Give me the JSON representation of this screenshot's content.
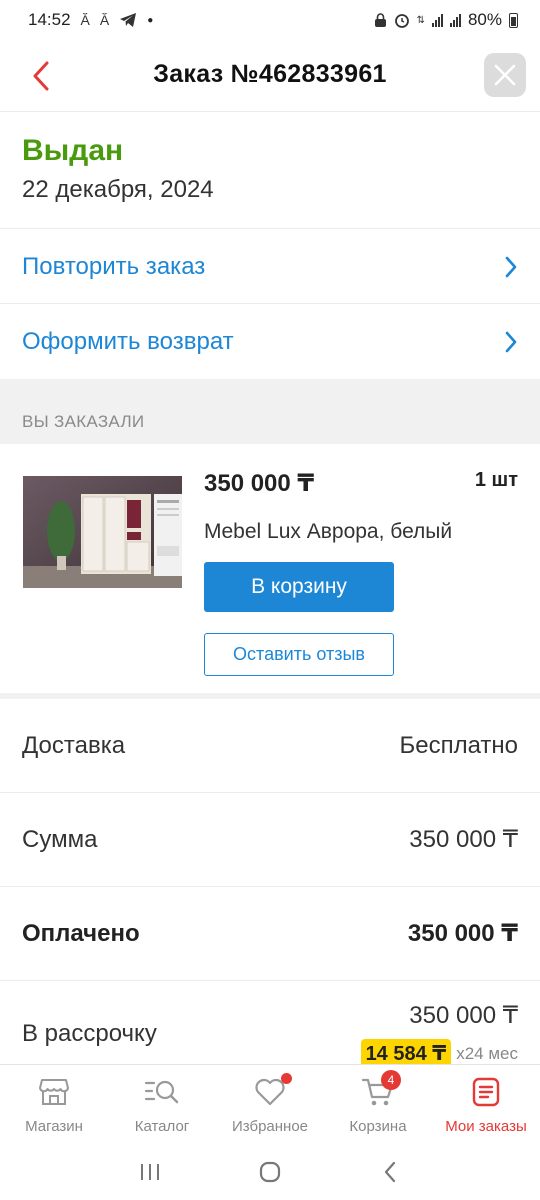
{
  "status_bar": {
    "time": "14:52",
    "battery": "80%"
  },
  "header": {
    "title": "Заказ №462833961"
  },
  "order": {
    "status": "Выдан",
    "date": "22 декабря, 2024"
  },
  "actions": [
    {
      "label": "Повторить заказ"
    },
    {
      "label": "Оформить возврат"
    }
  ],
  "section_title": "ВЫ ЗАКАЗАЛИ",
  "product": {
    "price": "350 000 ₸",
    "quantity": "1 шт",
    "name": "Mebel Lux Аврора, белый",
    "cart_button": "В корзину",
    "review_button": "Оставить отзыв"
  },
  "summary": {
    "delivery_label": "Доставка",
    "delivery_value": "Бесплатно",
    "sum_label": "Сумма",
    "sum_value": "350 000 ₸",
    "paid_label": "Оплачено",
    "paid_value": "350 000 ₸",
    "installment_label": "В рассрочку",
    "installment_value": "350 000 ₸",
    "installment_monthly": "14 584 ₸",
    "installment_term": "x24 мес"
  },
  "bottom_nav": [
    {
      "label": "Магазин",
      "icon": "shop-icon"
    },
    {
      "label": "Каталог",
      "icon": "catalog-search-icon"
    },
    {
      "label": "Избранное",
      "icon": "heart-icon"
    },
    {
      "label": "Корзина",
      "icon": "cart-icon",
      "badge": "4"
    },
    {
      "label": "Мои заказы",
      "icon": "orders-icon",
      "active": true
    }
  ],
  "colors": {
    "accent_blue": "#1d87d6",
    "status_green": "#4a9a0f",
    "active_red": "#e53935",
    "installment_yellow": "#ffd500"
  }
}
